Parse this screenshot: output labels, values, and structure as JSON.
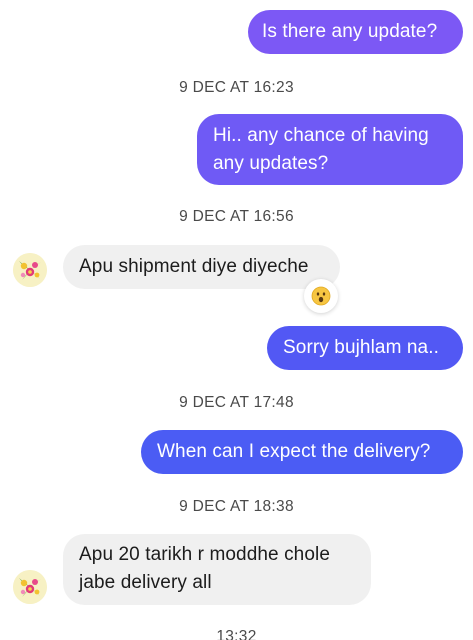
{
  "colors": {
    "outgoing_gradient_top": "#8b4ff5",
    "outgoing_gradient_bottom": "#4a5cf4",
    "incoming_bubble": "#f0f0f0",
    "timestamp_text": "#4a4a4a"
  },
  "messages": {
    "m1": {
      "sender": "me",
      "text": "Is there any update?"
    },
    "t1": {
      "text": "9 DEC AT 16:23"
    },
    "m2": {
      "sender": "me",
      "line1": "Hi.. any chance of having",
      "line2": "any updates?"
    },
    "t2": {
      "text": "9 DEC AT 16:56"
    },
    "m3": {
      "sender": "contact",
      "text": "Apu shipment diye diyeche",
      "reaction": "surprised-face"
    },
    "m4": {
      "sender": "me",
      "text": "Sorry bujhlam na.."
    },
    "t3": {
      "text": "9 DEC AT 17:48"
    },
    "m5": {
      "sender": "me",
      "text": "When can I expect the delivery?"
    },
    "t4": {
      "text": "9 DEC AT 18:38"
    },
    "m6": {
      "sender": "contact",
      "line1": "Apu 20 tarikh r moddhe chole",
      "line2": "jabe delivery all"
    },
    "t5": {
      "text": "13:32"
    }
  },
  "avatar": {
    "icon": "floral-avatar-icon"
  }
}
